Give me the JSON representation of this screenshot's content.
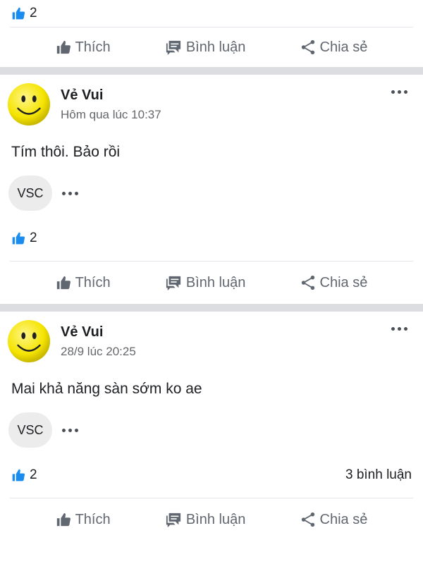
{
  "colors": {
    "like_blue": "#1a8cf0",
    "action_gray": "#606770",
    "separator": "#dcdde1",
    "avatar_yellow": "#f5e400"
  },
  "top_fragment": {
    "like_count": "2",
    "actions": {
      "like": "Thích",
      "comment": "Bình luận",
      "share": "Chia sẻ"
    }
  },
  "posts": [
    {
      "author": "Vẻ Vui",
      "timestamp": "Hôm qua lúc 10:37",
      "text": "Tím thôi. Bảo rồi",
      "reactor_label": "VSC",
      "like_count": "2",
      "comment_count": "",
      "actions": {
        "like": "Thích",
        "comment": "Bình luận",
        "share": "Chia sẻ"
      }
    },
    {
      "author": "Vẻ Vui",
      "timestamp": "28/9 lúc 20:25",
      "text": "Mai khả năng sàn sớm ko ae",
      "reactor_label": "VSC",
      "like_count": "2",
      "comment_count": "3 bình luận",
      "actions": {
        "like": "Thích",
        "comment": "Bình luận",
        "share": "Chia sẻ"
      }
    }
  ]
}
